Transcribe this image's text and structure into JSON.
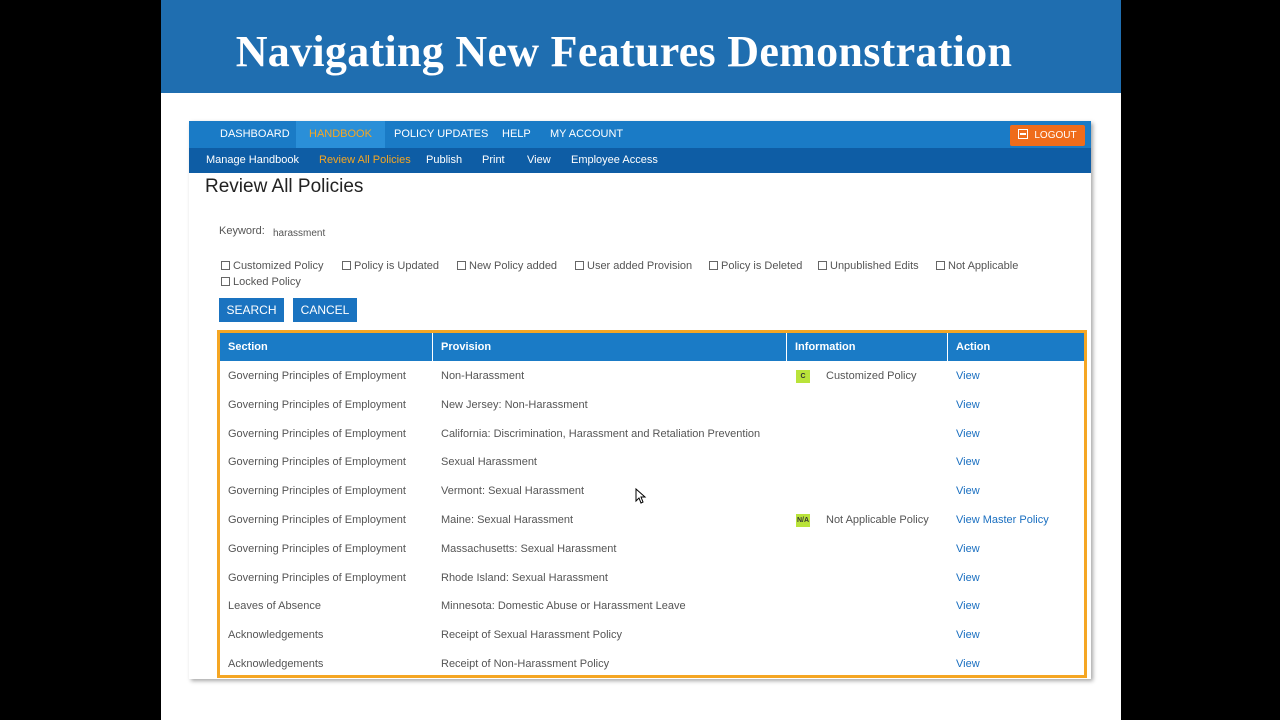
{
  "slide": {
    "title": "Navigating New Features Demonstration"
  },
  "topnav": {
    "items": [
      "DASHBOARD",
      "HANDBOOK",
      "POLICY UPDATES",
      "HELP",
      "MY ACCOUNT"
    ],
    "active": "HANDBOOK",
    "logout": "LOGOUT"
  },
  "subnav": {
    "items": [
      "Manage Handbook",
      "Review All Policies",
      "Publish",
      "Print",
      "View",
      "Employee Access"
    ],
    "active": "Review All Policies"
  },
  "page": {
    "title": "Review All Policies"
  },
  "search": {
    "keyword_label": "Keyword:",
    "keyword_value": "harassment"
  },
  "filters": [
    "Customized Policy",
    "Policy is Updated",
    "New Policy added",
    "User added Provision",
    "Policy is Deleted",
    "Unpublished Edits",
    "Not Applicable",
    "Locked Policy"
  ],
  "buttons": {
    "search": "SEARCH",
    "cancel": "CANCEL"
  },
  "table": {
    "headers": [
      "Section",
      "Provision",
      "Information",
      "Action"
    ],
    "rows": [
      {
        "section": "Governing Principles of Employment",
        "provision": "Non-Harassment",
        "badge": "C",
        "info": "Customized Policy",
        "action": "View"
      },
      {
        "section": "Governing Principles of Employment",
        "provision": "New Jersey: Non-Harassment",
        "badge": "",
        "info": "",
        "action": "View"
      },
      {
        "section": "Governing Principles of Employment",
        "provision": "California: Discrimination, Harassment and Retaliation Prevention",
        "badge": "",
        "info": "",
        "action": "View"
      },
      {
        "section": "Governing Principles of Employment",
        "provision": "Sexual Harassment",
        "badge": "",
        "info": "",
        "action": "View"
      },
      {
        "section": "Governing Principles of Employment",
        "provision": "Vermont: Sexual Harassment",
        "badge": "",
        "info": "",
        "action": "View"
      },
      {
        "section": "Governing Principles of Employment",
        "provision": "Maine: Sexual Harassment",
        "badge": "N/A",
        "info": "Not Applicable Policy",
        "action": "View Master Policy"
      },
      {
        "section": "Governing Principles of Employment",
        "provision": "Massachusetts: Sexual Harassment",
        "badge": "",
        "info": "",
        "action": "View"
      },
      {
        "section": "Governing Principles of Employment",
        "provision": "Rhode Island: Sexual Harassment",
        "badge": "",
        "info": "",
        "action": "View"
      },
      {
        "section": "Leaves of Absence",
        "provision": "Minnesota: Domestic Abuse or Harassment Leave",
        "badge": "",
        "info": "",
        "action": "View"
      },
      {
        "section": "Acknowledgements",
        "provision": "Receipt of Sexual Harassment Policy",
        "badge": "",
        "info": "",
        "action": "View"
      },
      {
        "section": "Acknowledgements",
        "provision": "Receipt of Non-Harassment Policy",
        "badge": "",
        "info": "",
        "action": "View"
      }
    ]
  },
  "colors": {
    "header_blue": "#1f6eb0",
    "nav_blue": "#1a7bc6",
    "subnav_blue": "#0e5da5",
    "accent_orange": "#f5a623",
    "logout_orange": "#ef6c1b",
    "badge_green": "#b9e33a"
  }
}
